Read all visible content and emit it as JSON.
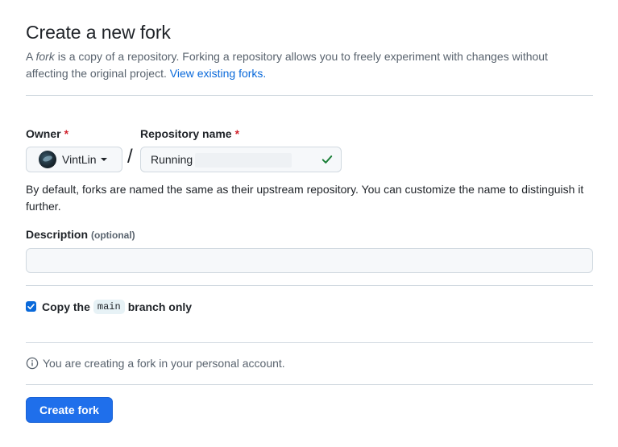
{
  "page": {
    "title": "Create a new fork",
    "subtitle_prefix": "A ",
    "subtitle_em": "fork",
    "subtitle_rest": " is a copy of a repository. Forking a repository allows you to freely experiment with changes without affecting the original project. ",
    "view_forks_link": "View existing forks."
  },
  "owner": {
    "label": "Owner",
    "required_mark": "*",
    "name": "VintLin"
  },
  "separator": "/",
  "repository": {
    "label": "Repository name",
    "required_mark": "*",
    "value": "Running"
  },
  "hint": "By default, forks are named the same as their upstream repository. You can customize the name to distinguish it further.",
  "description": {
    "label": "Description",
    "optional": "(optional)",
    "value": "",
    "placeholder": ""
  },
  "copy_branch": {
    "checked": true,
    "label_before": "Copy the",
    "branch": "main",
    "label_after": "branch only"
  },
  "info": "You are creating a fork in your personal account.",
  "submit": {
    "label": "Create fork"
  },
  "colors": {
    "accent": "#1f6feb",
    "link": "#0969da",
    "required": "#d1242f",
    "success": "#1a7f37"
  },
  "icons": [
    "chevron-down-icon",
    "check-icon",
    "info-icon"
  ]
}
